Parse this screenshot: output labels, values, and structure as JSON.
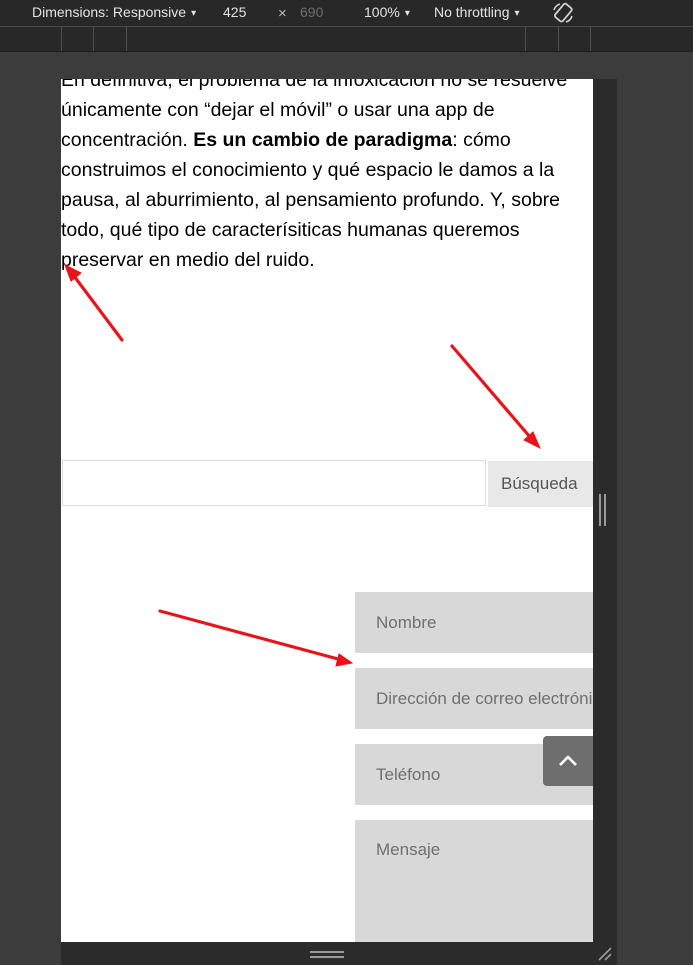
{
  "devtools": {
    "dimensions_label": "Dimensions: Responsive",
    "width_value": "425",
    "times": "×",
    "height_value": "690",
    "zoom": "100%",
    "throttling": "No throttling",
    "caret": "▾"
  },
  "article": {
    "text_before_bold": "En definitiva, el problema de la infoxicación no se resuelve únicamente con “dejar el móvil” o usar una app de concentración. ",
    "bold_text": "Es un cambio de paradigma",
    "text_after_bold": ": cómo construimos el conocimiento y qué espacio le damos a la pausa, al aburrimiento, al pensamiento profundo. Y, sobre todo, qué tipo de caracterísiticas humanas queremos preservar en medio del ruido."
  },
  "search": {
    "input_value": "",
    "button_label": "Búsqueda"
  },
  "form": {
    "name_placeholder": "Nombre",
    "email_placeholder": "Dirección de correo electrónico",
    "phone_placeholder": "Teléfono",
    "message_placeholder": "Mensaje"
  },
  "colors": {
    "annotation_arrow": "#e8141c",
    "field_background": "#d8d8d8",
    "scroll_top_button": "#6e6e6e"
  }
}
